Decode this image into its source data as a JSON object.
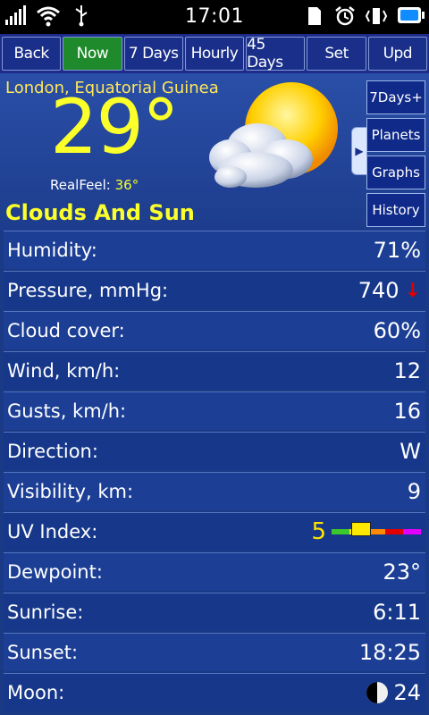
{
  "status": {
    "time": "17:01"
  },
  "nav": {
    "items": [
      {
        "label": "Back",
        "active": false
      },
      {
        "label": "Now",
        "active": true
      },
      {
        "label": "7 Days",
        "active": false
      },
      {
        "label": "Hourly",
        "active": false
      },
      {
        "label": "45 Days",
        "active": false
      },
      {
        "label": "Set",
        "active": false
      },
      {
        "label": "Upd",
        "active": false
      }
    ]
  },
  "current": {
    "location": "London, Equatorial Guinea",
    "temperature": "29°",
    "realfeel_label": "RealFeel:",
    "realfeel_value": "36°",
    "condition": "Clouds And Sun",
    "icon": "partly-cloudy-icon"
  },
  "side_menu": {
    "items": [
      "7Days+",
      "Planets",
      "Graphs",
      "History"
    ]
  },
  "details": [
    {
      "name": "humidity",
      "label": "Humidity:",
      "value": "71%"
    },
    {
      "name": "pressure",
      "label": "Pressure, mmHg:",
      "value": "740"
    },
    {
      "name": "cloud-cover",
      "label": "Cloud cover:",
      "value": "60%"
    },
    {
      "name": "wind",
      "label": "Wind, km/h:",
      "value": "12"
    },
    {
      "name": "gusts",
      "label": "Gusts, km/h:",
      "value": "16"
    },
    {
      "name": "direction",
      "label": "Direction:",
      "value": "W"
    },
    {
      "name": "visibility",
      "label": "Visibility, km:",
      "value": "9"
    },
    {
      "name": "uv-index",
      "label": "UV Index:",
      "value": "5"
    },
    {
      "name": "dewpoint",
      "label": "Dewpoint:",
      "value": "23°"
    },
    {
      "name": "sunrise",
      "label": "Sunrise:",
      "value": "6:11"
    },
    {
      "name": "sunset",
      "label": "Sunset:",
      "value": "18:25"
    },
    {
      "name": "moon",
      "label": "Moon:",
      "value": "24"
    }
  ],
  "colors": {
    "accent_yellow": "#fbff2a",
    "active_tab": "#1f8a2c",
    "background": "#1a3a85",
    "pressure_trend": "#e20000"
  },
  "uv_scale": [
    "#3cc82b",
    "#ffe900",
    "#ff8a00",
    "#e20000",
    "#e100ff"
  ]
}
